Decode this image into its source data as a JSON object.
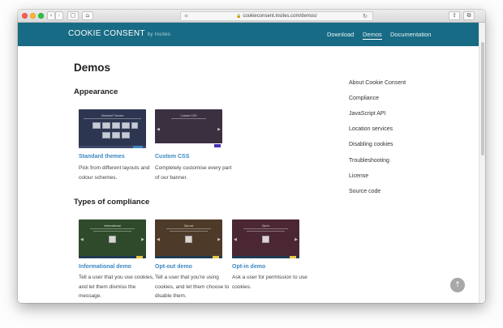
{
  "browser": {
    "url": "cookieconsent.insites.com/demos/",
    "back_glyph": "‹",
    "forward_glyph": "›",
    "sidebar_glyph": "▢",
    "home_glyph": "⌂",
    "reload_glyph": "↻",
    "share_glyph": "⇧",
    "tabs_glyph": "⧉",
    "lock_glyph": "🔒",
    "menu_glyph": "≡",
    "traffic_lights": {
      "close": "#fd5f57",
      "minimize": "#febb2e",
      "zoom": "#28c840"
    }
  },
  "site": {
    "logo": "COOKIE CONSENT",
    "logo_by": "by Insites",
    "header_color": "#186b84",
    "nav": [
      {
        "label": "Download"
      },
      {
        "label": "Demos"
      },
      {
        "label": "Documentation"
      }
    ]
  },
  "page": {
    "title": "Demos",
    "sections": [
      {
        "heading": "Appearance"
      },
      {
        "heading": "Types of compliance"
      }
    ],
    "cards": [
      {
        "title": "Standard themes",
        "desc": "Pick from different layouts and colour schemes."
      },
      {
        "title": "Custom CSS",
        "desc": "Completely customise every part of our banner."
      },
      {
        "title": "Informational demo",
        "desc": "Tell a user that you use cookies, and let them dismiss the message."
      },
      {
        "title": "Opt-out demo",
        "desc": "Tell a user that you're using cookies, and let them choose to disable them."
      },
      {
        "title": "Opt-in demo",
        "desc": "Ask a user for permission to use cookies."
      }
    ],
    "thumbnail_labels": [
      "Standard Themes",
      "Custom CSS",
      "Informational",
      "Opt-out",
      "Opt-in"
    ]
  },
  "sidebar": {
    "items": [
      {
        "label": "About Cookie Consent"
      },
      {
        "label": "Compliance"
      },
      {
        "label": "JavaScript API"
      },
      {
        "label": "Location services"
      },
      {
        "label": "Disabling cookies"
      },
      {
        "label": "Troubleshooting"
      },
      {
        "label": "License"
      },
      {
        "label": "Source code"
      }
    ]
  },
  "scroll_top_glyph": "↑"
}
